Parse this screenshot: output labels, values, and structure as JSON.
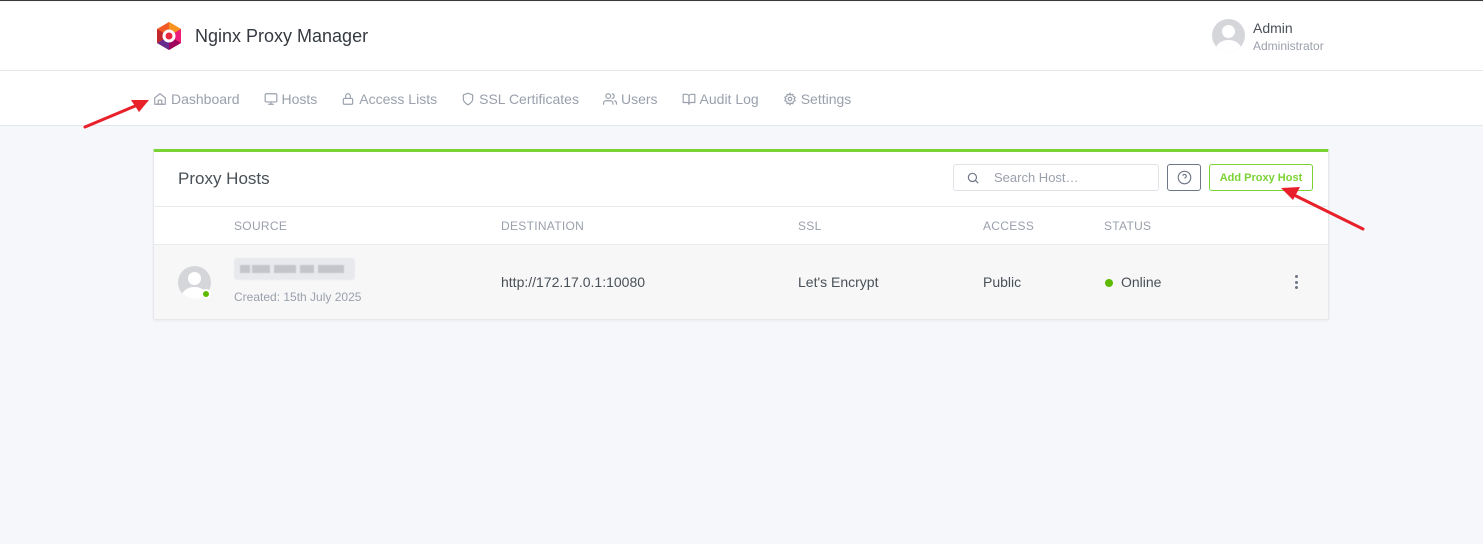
{
  "app": {
    "title": "Nginx Proxy Manager",
    "logo_icon": "npm-logo-icon"
  },
  "user": {
    "name": "Admin",
    "role": "Administrator"
  },
  "nav": {
    "items": [
      {
        "label": "Dashboard",
        "icon": "home-icon"
      },
      {
        "label": "Hosts",
        "icon": "monitor-icon"
      },
      {
        "label": "Access Lists",
        "icon": "lock-icon"
      },
      {
        "label": "SSL Certificates",
        "icon": "shield-icon"
      },
      {
        "label": "Users",
        "icon": "users-icon"
      },
      {
        "label": "Audit Log",
        "icon": "book-icon"
      },
      {
        "label": "Settings",
        "icon": "gear-icon"
      }
    ]
  },
  "card": {
    "title": "Proxy Hosts",
    "search_placeholder": "Search Host…",
    "add_button": "Add Proxy Host",
    "accent_color": "#7bd235",
    "columns": [
      "SOURCE",
      "DESTINATION",
      "SSL",
      "ACCESS",
      "STATUS"
    ],
    "rows": [
      {
        "created": "Created: 15th July 2025",
        "destination": "http://172.17.0.1:10080",
        "ssl": "Let's Encrypt",
        "access": "Public",
        "status": "Online",
        "status_color": "#5eba00"
      }
    ]
  },
  "annotations": {
    "arrow_color": "#e8202a"
  }
}
